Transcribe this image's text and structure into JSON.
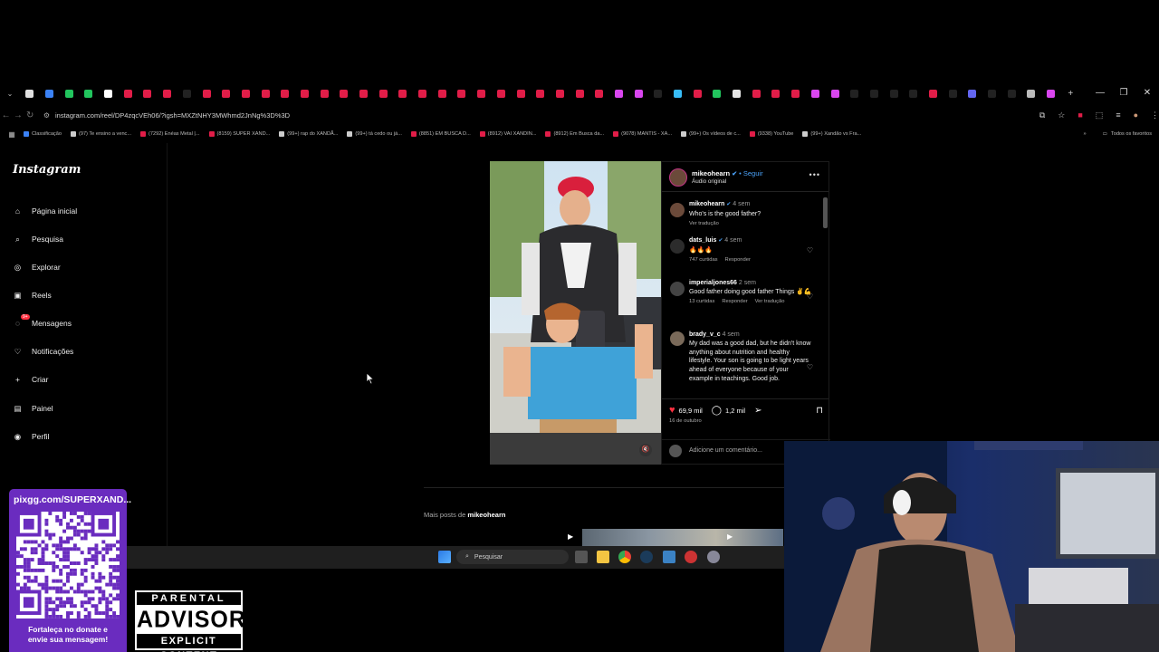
{
  "browser": {
    "url": "instagram.com/reel/DP4zqcVEh06/?igsh=MXZtNHY3MWhmd2JnNg%3D%3D",
    "tab_colors": [
      "#e0e0e0",
      "#3b82f6",
      "#22c55e",
      "#22c55e",
      "#ffffff",
      "#e11d48",
      "#e11d48",
      "#e11d48",
      "#222",
      "#e11d48",
      "#e11d48",
      "#e11d48",
      "#e11d48",
      "#e11d48",
      "#e11d48",
      "#e11d48",
      "#e11d48",
      "#e11d48",
      "#e11d48",
      "#e11d48",
      "#e11d48",
      "#e11d48",
      "#e11d48",
      "#e11d48",
      "#e11d48",
      "#e11d48",
      "#e11d48",
      "#e11d48",
      "#e11d48",
      "#e11d48",
      "#d946ef",
      "#d946ef",
      "#222",
      "#38bdf8",
      "#e11d48",
      "#22c55e",
      "#e5e5e5",
      "#e11d48",
      "#e11d48",
      "#e11d48",
      "#d946ef",
      "#d946ef",
      "#222",
      "#222",
      "#222",
      "#222",
      "#e11d48",
      "#222",
      "#6366f1",
      "#222",
      "#222",
      "#bbb",
      "#d946ef"
    ],
    "bookmarks": [
      {
        "label": "Classificação",
        "color": "#3b82f6"
      },
      {
        "label": "(97) Te ensino a venc...",
        "color": "#ccc"
      },
      {
        "label": "(7292) Enéas Metal |...",
        "color": "#e11d48"
      },
      {
        "label": "(8159) SUPER XAND...",
        "color": "#e11d48"
      },
      {
        "label": "(99+) rap do XANDÃ...",
        "color": "#ccc"
      },
      {
        "label": "(99+) tá cedo ou já...",
        "color": "#ccc"
      },
      {
        "label": "(8851) EM BUSCA D...",
        "color": "#e11d48"
      },
      {
        "label": "(8912) VAI XANDIN...",
        "color": "#e11d48"
      },
      {
        "label": "(8912) Em Busca da...",
        "color": "#e11d48"
      },
      {
        "label": "(9078) MANTIS - XA...",
        "color": "#e11d48"
      },
      {
        "label": "(99+) Os vídeos de c...",
        "color": "#ccc"
      },
      {
        "label": "(9338) YouTube",
        "color": "#e11d48"
      },
      {
        "label": "(99+) Xandão vs Fra...",
        "color": "#ccc"
      }
    ],
    "bookmarks_all": "Todos os favoritos"
  },
  "sidebar": {
    "logo": "Instagram",
    "items": [
      {
        "label": "Página inicial",
        "icon": "home-icon"
      },
      {
        "label": "Pesquisa",
        "icon": "search-icon"
      },
      {
        "label": "Explorar",
        "icon": "compass-icon"
      },
      {
        "label": "Reels",
        "icon": "reels-icon"
      },
      {
        "label": "Mensagens",
        "icon": "messenger-icon",
        "badge": "9+"
      },
      {
        "label": "Notificações",
        "icon": "heart-icon"
      },
      {
        "label": "Criar",
        "icon": "plus-icon"
      },
      {
        "label": "Painel",
        "icon": "dashboard-icon"
      },
      {
        "label": "Perfil",
        "icon": "profile-icon"
      }
    ]
  },
  "post": {
    "author": "mikeohearn",
    "follow": "• Seguir",
    "audio": "Áudio original",
    "caption_time": "4 sem",
    "caption": "Who's is the good father?",
    "see_translation": "Ver tradução",
    "comments": [
      {
        "user": "dats_luis",
        "time": "4 sem",
        "text": "🔥🔥🔥",
        "likes": "747 curtidas",
        "reply": "Responder",
        "translate": ""
      },
      {
        "user": "imperialjones66",
        "time": "2 sem",
        "text": "Good father doing good father Things ✌️💪",
        "likes": "13 curtidas",
        "reply": "Responder",
        "translate": "Ver tradução"
      },
      {
        "user": "brady_v_c",
        "time": "4 sem",
        "text": "My dad was a good dad, but he didn't know anything about nutrition and healthy lifestyle. Your son is going to be light years ahead of everyone because of your example in teachings. Good job.",
        "likes": "",
        "reply": "",
        "translate": ""
      }
    ],
    "likes_count": "69,9 mil",
    "comments_count": "1,2 mil",
    "date": "16 de outubro",
    "add_comment_placeholder": "Adicione um comentário...",
    "more_posts_prefix": "Mais posts de",
    "more_posts_user": "mikeohearn"
  },
  "taskbar": {
    "search": "Pesquisar"
  },
  "overlay": {
    "donate_url": "pixgg.com/SUPERXAND...",
    "donate_msg_1": "Fortaleça no donate e",
    "donate_msg_2": "envie sua mensagem!",
    "advisory_top": "PARENTAL",
    "advisory_mid": "ADVISORY",
    "advisory_bot": "EXPLICIT CONTENT"
  }
}
